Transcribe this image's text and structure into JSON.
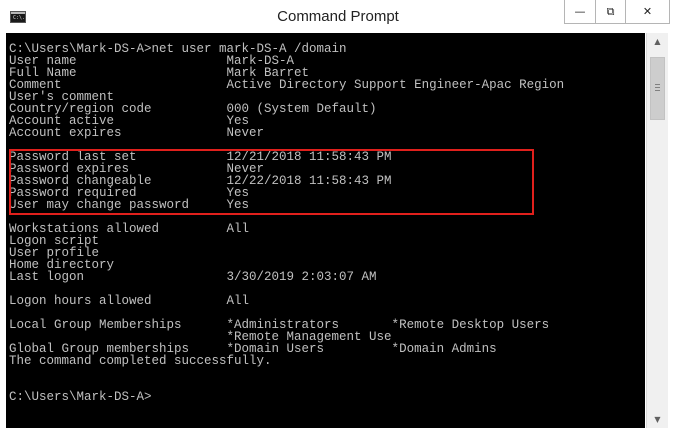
{
  "window": {
    "title": "Command Prompt",
    "app_icon_text": "C:\\.",
    "minimize_glyph": "—",
    "maximize_glyph": "⧉",
    "close_glyph": "✕"
  },
  "console": {
    "lines": [
      "C:\\Users\\Mark-DS-A>net user mark-DS-A /domain",
      "User name                    Mark-DS-A",
      "Full Name                    Mark Barret",
      "Comment                      Active Directory Support Engineer-Apac Region",
      "User's comment",
      "Country/region code          000 (System Default)",
      "Account active               Yes",
      "Account expires              Never",
      "",
      "Password last set            12/21/2018 11:58:43 PM",
      "Password expires             Never",
      "Password changeable          12/22/2018 11:58:43 PM",
      "Password required            Yes",
      "User may change password     Yes",
      "",
      "Workstations allowed         All",
      "Logon script",
      "User profile",
      "Home directory",
      "Last logon                   3/30/2019 2:03:07 AM",
      "",
      "Logon hours allowed          All",
      "",
      "Local Group Memberships      *Administrators       *Remote Desktop Users",
      "                             *Remote Management Use",
      "Global Group memberships     *Domain Users         *Domain Admins",
      "The command completed successfully.",
      "",
      "",
      "C:\\Users\\Mark-DS-A>"
    ]
  },
  "scrollbar": {
    "up_glyph": "▲",
    "down_glyph": "▼"
  }
}
